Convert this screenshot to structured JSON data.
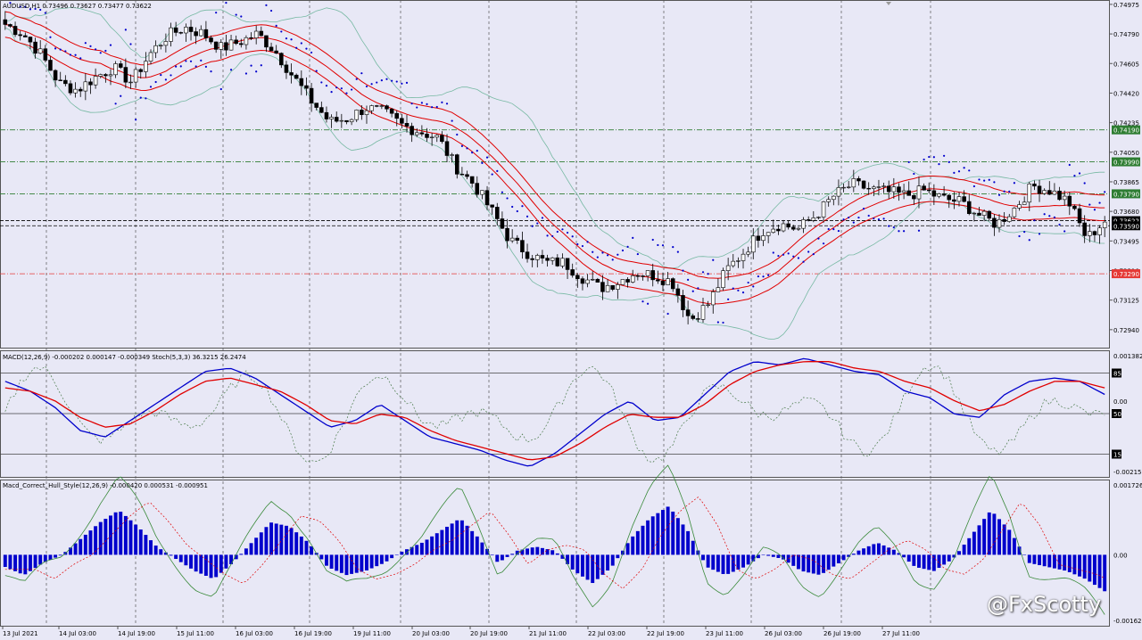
{
  "chart_data": [
    {
      "type": "candlestick",
      "title": "AUDUSD,H1  0.73496 0.73627 0.73477 0.73622",
      "ylim": [
        0.7285,
        0.7498
      ],
      "y_tick_labels": [
        "0.74975",
        "0.74790",
        "0.74605",
        "0.74420",
        "0.74235",
        "0.74050",
        "0.73865",
        "0.73680",
        "0.73495",
        "0.73310",
        "0.73125",
        "0.72940"
      ],
      "x_tick_labels": [
        "13 Jul 2021",
        "14 Jul 03:00",
        "14 Jul 19:00",
        "15 Jul 11:00",
        "16 Jul 03:00",
        "16 Jul 19:00",
        "19 Jul 11:00",
        "20 Jul 03:00",
        "20 Jul 19:00",
        "21 Jul 11:00",
        "22 Jul 03:00",
        "22 Jul 19:00",
        "23 Jul 11:00",
        "26 Jul 03:00",
        "26 Jul 19:00",
        "27 Jul 11:00"
      ],
      "close_path": [
        0.7485,
        0.7479,
        0.7466,
        0.7448,
        0.7444,
        0.7452,
        0.7458,
        0.7449,
        0.7466,
        0.7478,
        0.7483,
        0.7479,
        0.747,
        0.7474,
        0.7479,
        0.7468,
        0.7452,
        0.7437,
        0.7424,
        0.7426,
        0.7433,
        0.743,
        0.7422,
        0.7418,
        0.7414,
        0.7396,
        0.7385,
        0.7368,
        0.735,
        0.7342,
        0.7336,
        0.7336,
        0.7327,
        0.732,
        0.7324,
        0.733,
        0.7328,
        0.7324,
        0.73,
        0.731,
        0.7331,
        0.7343,
        0.7356,
        0.736,
        0.7357,
        0.7366,
        0.7378,
        0.7385,
        0.7382,
        0.738,
        0.7378,
        0.7381,
        0.7376,
        0.7374,
        0.7366,
        0.736,
        0.737,
        0.7384,
        0.7381,
        0.7374,
        0.7351,
        0.7362
      ],
      "horizontal_levels": [
        {
          "value": 0.7419,
          "label": "0.74190",
          "color": "#2e7d32"
        },
        {
          "value": 0.7399,
          "label": "0.73990",
          "color": "#2e7d32"
        },
        {
          "value": 0.7379,
          "label": "0.73790",
          "color": "#2e7d32"
        },
        {
          "value": 0.73622,
          "label": "0.73622",
          "color": "#000000"
        },
        {
          "value": 0.7359,
          "label": "0.73590",
          "color": "#000000"
        },
        {
          "value": 0.7329,
          "label": "0.73290",
          "color": "#e53935"
        }
      ],
      "overlays": [
        "Bollinger Bands",
        "Envelopes",
        "Parabolic SAR"
      ],
      "colors": {
        "background": "#e8e8f6",
        "candle": "#000000",
        "envelope": "#e00000",
        "bollinger": "#77b9a3",
        "sar": "#0000cc"
      }
    },
    {
      "type": "line",
      "title": "MACD(12,26,9) -0.000202 0.000147 -0.000349  Stoch(5,3,3) 36.3215 26.2474",
      "y_tick_labels": [
        "0.001382",
        "0.00",
        "-0.002151"
      ],
      "level_tags": [
        "85",
        "50",
        "15"
      ],
      "series": [
        {
          "name": "MACD",
          "color": "#0000cc",
          "values": [
            0.0006,
            0.0003,
            -0.0002,
            -0.0009,
            -0.0011,
            -0.0006,
            -0.0001,
            0.0004,
            0.0009,
            0.001,
            0.0007,
            0.0002,
            -0.0003,
            -0.0008,
            -0.0006,
            -0.0001,
            -0.0006,
            -0.0011,
            -0.0013,
            -0.0015,
            -0.0018,
            -0.002,
            -0.0016,
            -0.001,
            -0.0004,
            0.0,
            -0.0006,
            -0.0005,
            0.0002,
            0.0009,
            0.0012,
            0.0011,
            0.0013,
            0.0011,
            0.0009,
            0.0008,
            0.0003,
            0.0001,
            -0.0004,
            -0.0005,
            0.0002,
            0.0006,
            0.0007,
            0.0006,
            0.0002
          ]
        },
        {
          "name": "Signal",
          "color": "#e00000",
          "values": [
            0.0004,
            0.0003,
            0.0,
            -0.0005,
            -0.0008,
            -0.0007,
            -0.0003,
            0.0002,
            0.0006,
            0.0007,
            0.0005,
            0.0003,
            -0.0001,
            -0.0006,
            -0.0007,
            -0.0004,
            -0.0005,
            -0.0009,
            -0.0012,
            -0.0014,
            -0.0016,
            -0.0018,
            -0.0017,
            -0.0013,
            -0.0008,
            -0.0004,
            -0.0005,
            -0.0005,
            -0.0001,
            0.0005,
            0.0009,
            0.0011,
            0.0012,
            0.0012,
            0.001,
            0.0009,
            0.0006,
            0.0004,
            0.0,
            -0.0003,
            -0.0001,
            0.0003,
            0.0006,
            0.0006,
            0.0004
          ]
        }
      ]
    },
    {
      "type": "bar",
      "title": "Macd_Correct_Hull_Style(12,26,9) -0.000420 0.000531 -0.000951",
      "y_tick_labels": [
        "0.001726",
        "0.00",
        "-0.00162"
      ],
      "values": [
        -0.0003,
        -0.0005,
        -0.0002,
        0.0,
        0.0004,
        0.0008,
        0.0011,
        0.0007,
        0.0002,
        -0.0001,
        -0.0004,
        -0.0006,
        -0.0002,
        0.0003,
        0.0008,
        0.0007,
        0.0003,
        -0.0003,
        -0.0005,
        -0.0004,
        -0.0002,
        0.0001,
        0.0003,
        0.0006,
        0.0009,
        0.0004,
        -0.0002,
        0.0001,
        0.0002,
        0.0001,
        -0.0004,
        -0.0007,
        -0.0003,
        0.0004,
        0.0009,
        0.0012,
        0.0006,
        -0.0003,
        -0.0005,
        -0.0003,
        0.0,
        -0.0001,
        -0.0004,
        -0.0005,
        -0.0002,
        0.0001,
        0.0003,
        0.0001,
        -0.0003,
        -0.0004,
        -0.0001,
        0.0005,
        0.0011,
        0.0006,
        -0.0002,
        -0.0003,
        -0.0004,
        -0.0006,
        -0.0009
      ],
      "colors": {
        "histogram": "#0000cc",
        "line1": "#3a8a3a",
        "line2": "#e00000"
      }
    }
  ],
  "watermark": "@FxScotty"
}
